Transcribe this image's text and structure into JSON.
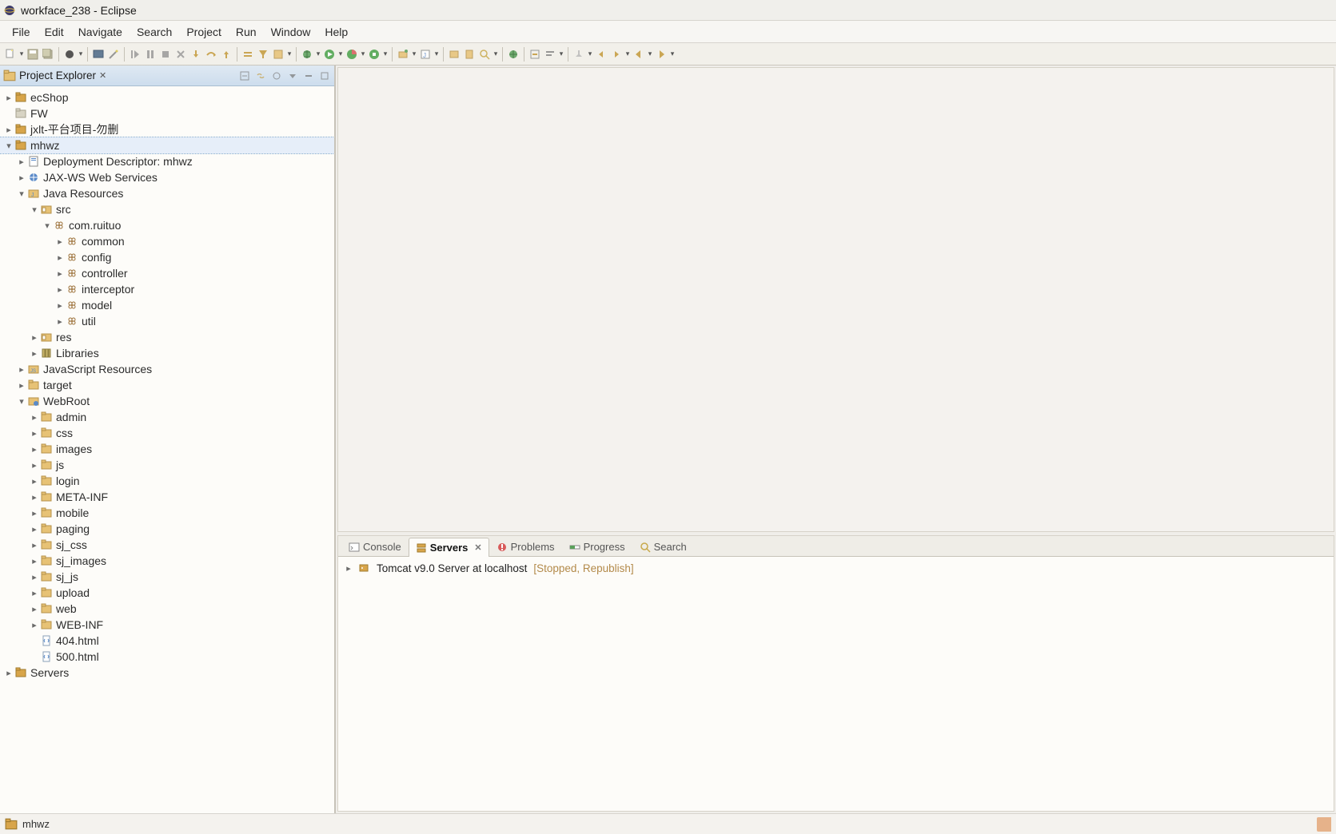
{
  "window": {
    "title": "workface_238 - Eclipse"
  },
  "menu": [
    "File",
    "Edit",
    "Navigate",
    "Search",
    "Project",
    "Run",
    "Window",
    "Help"
  ],
  "project_explorer": {
    "title": "Project Explorer",
    "projects": {
      "ecShop": "ecShop",
      "FW": "FW",
      "jxlt": "jxlt-平台项目-勿删",
      "mhwz": "mhwz",
      "servers": "Servers"
    },
    "mhwz": {
      "deployment_descriptor": "Deployment Descriptor: mhwz",
      "jax_ws": "JAX-WS Web Services",
      "java_resources": "Java Resources",
      "src": "src",
      "com_ruituo": "com.ruituo",
      "packages": [
        "common",
        "config",
        "controller",
        "interceptor",
        "model",
        "util"
      ],
      "res": "res",
      "libraries": "Libraries",
      "js_resources": "JavaScript Resources",
      "target": "target",
      "webroot": "WebRoot",
      "webroot_folders": [
        "admin",
        "css",
        "images",
        "js",
        "login",
        "META-INF",
        "mobile",
        "paging",
        "sj_css",
        "sj_images",
        "sj_js",
        "upload",
        "web",
        "WEB-INF"
      ],
      "webroot_files": [
        "404.html",
        "500.html"
      ]
    }
  },
  "bottom_tabs": {
    "console": "Console",
    "servers": "Servers",
    "problems": "Problems",
    "progress": "Progress",
    "search": "Search"
  },
  "servers_panel": {
    "server_name": "Tomcat v9.0 Server at localhost",
    "server_status": "[Stopped, Republish]"
  },
  "statusbar": {
    "selection": "mhwz"
  }
}
